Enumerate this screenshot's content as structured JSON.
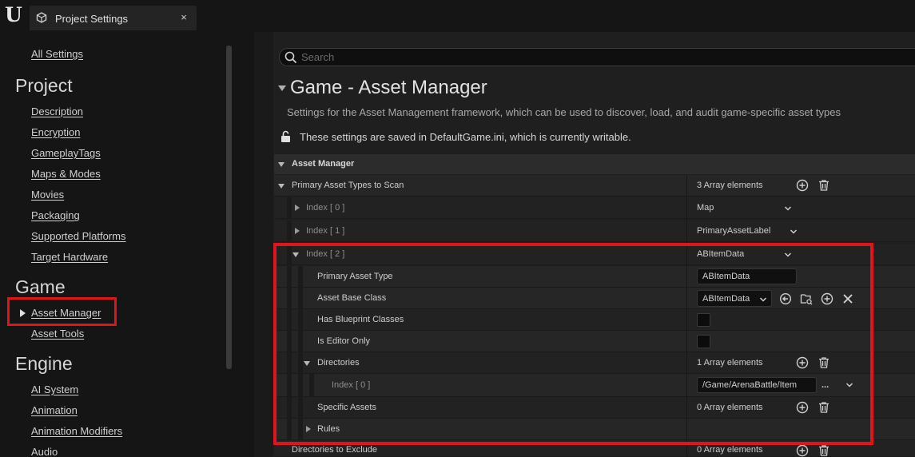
{
  "window": {
    "tab_title": "Project Settings",
    "close_glyph": "×",
    "logo_glyph": "U"
  },
  "sidebar": {
    "all_settings": "All Settings",
    "sections": [
      {
        "heading": "Project",
        "items": [
          "Description",
          "Encryption",
          "GameplayTags",
          "Maps & Modes",
          "Movies",
          "Packaging",
          "Supported Platforms",
          "Target Hardware"
        ]
      },
      {
        "heading": "Game",
        "items": [
          "Asset Manager",
          "Asset Tools"
        ]
      },
      {
        "heading": "Engine",
        "items": [
          "AI System",
          "Animation",
          "Animation Modifiers",
          "Audio"
        ]
      }
    ],
    "selected": "Asset Manager"
  },
  "search": {
    "placeholder": "Search"
  },
  "panel": {
    "title": "Game - Asset Manager",
    "description": "Settings for the Asset Management framework, which can be used to discover, load, and audit game-specific asset types",
    "saved_note": "These settings are saved in DefaultGame.ini, which is currently writable."
  },
  "grid": {
    "category": "Asset Manager",
    "primary_types": {
      "label": "Primary Asset Types to Scan",
      "count": "3 Array elements",
      "index0": {
        "label": "Index [ 0 ]",
        "value": "Map"
      },
      "index1": {
        "label": "Index [ 1 ]",
        "value": "PrimaryAssetLabel"
      },
      "index2": {
        "label": "Index [ 2 ]",
        "value": "ABItemData",
        "primary_asset_type": {
          "label": "Primary Asset Type",
          "value": "ABItemData"
        },
        "asset_base_class": {
          "label": "Asset Base Class",
          "value": "ABItemData"
        },
        "has_blueprint_classes": {
          "label": "Has Blueprint Classes",
          "checked": false
        },
        "is_editor_only": {
          "label": "Is Editor Only",
          "checked": false
        },
        "directories": {
          "label": "Directories",
          "count": "1 Array elements",
          "index0": {
            "label": "Index [ 0 ]",
            "value": "/Game/ArenaBattle/Item",
            "more": "..."
          }
        },
        "specific_assets": {
          "label": "Specific Assets",
          "count": "0 Array elements"
        },
        "rules": {
          "label": "Rules"
        }
      }
    },
    "directories_to_exclude": {
      "label": "Directories to Exclude",
      "count": "0 Array elements"
    }
  },
  "colors": {
    "highlight": "#e0141c",
    "background": "#151515",
    "panel": "#1f1f1f"
  }
}
